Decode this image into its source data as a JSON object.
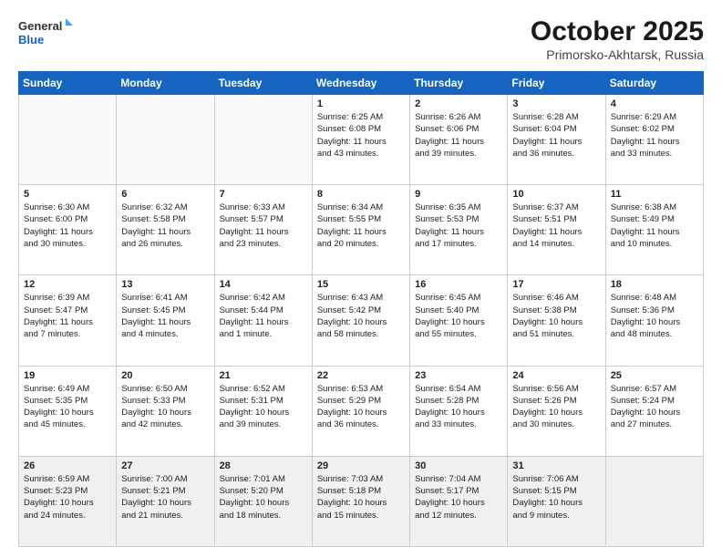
{
  "logo": {
    "line1": "General",
    "line2": "Blue"
  },
  "title": "October 2025",
  "subtitle": "Primorsko-Akhtarsk, Russia",
  "weekdays": [
    "Sunday",
    "Monday",
    "Tuesday",
    "Wednesday",
    "Thursday",
    "Friday",
    "Saturday"
  ],
  "weeks": [
    [
      {
        "day": "",
        "lines": []
      },
      {
        "day": "",
        "lines": []
      },
      {
        "day": "",
        "lines": []
      },
      {
        "day": "1",
        "lines": [
          "Sunrise: 6:25 AM",
          "Sunset: 6:08 PM",
          "Daylight: 11 hours",
          "and 43 minutes."
        ]
      },
      {
        "day": "2",
        "lines": [
          "Sunrise: 6:26 AM",
          "Sunset: 6:06 PM",
          "Daylight: 11 hours",
          "and 39 minutes."
        ]
      },
      {
        "day": "3",
        "lines": [
          "Sunrise: 6:28 AM",
          "Sunset: 6:04 PM",
          "Daylight: 11 hours",
          "and 36 minutes."
        ]
      },
      {
        "day": "4",
        "lines": [
          "Sunrise: 6:29 AM",
          "Sunset: 6:02 PM",
          "Daylight: 11 hours",
          "and 33 minutes."
        ]
      }
    ],
    [
      {
        "day": "5",
        "lines": [
          "Sunrise: 6:30 AM",
          "Sunset: 6:00 PM",
          "Daylight: 11 hours",
          "and 30 minutes."
        ]
      },
      {
        "day": "6",
        "lines": [
          "Sunrise: 6:32 AM",
          "Sunset: 5:58 PM",
          "Daylight: 11 hours",
          "and 26 minutes."
        ]
      },
      {
        "day": "7",
        "lines": [
          "Sunrise: 6:33 AM",
          "Sunset: 5:57 PM",
          "Daylight: 11 hours",
          "and 23 minutes."
        ]
      },
      {
        "day": "8",
        "lines": [
          "Sunrise: 6:34 AM",
          "Sunset: 5:55 PM",
          "Daylight: 11 hours",
          "and 20 minutes."
        ]
      },
      {
        "day": "9",
        "lines": [
          "Sunrise: 6:35 AM",
          "Sunset: 5:53 PM",
          "Daylight: 11 hours",
          "and 17 minutes."
        ]
      },
      {
        "day": "10",
        "lines": [
          "Sunrise: 6:37 AM",
          "Sunset: 5:51 PM",
          "Daylight: 11 hours",
          "and 14 minutes."
        ]
      },
      {
        "day": "11",
        "lines": [
          "Sunrise: 6:38 AM",
          "Sunset: 5:49 PM",
          "Daylight: 11 hours",
          "and 10 minutes."
        ]
      }
    ],
    [
      {
        "day": "12",
        "lines": [
          "Sunrise: 6:39 AM",
          "Sunset: 5:47 PM",
          "Daylight: 11 hours",
          "and 7 minutes."
        ]
      },
      {
        "day": "13",
        "lines": [
          "Sunrise: 6:41 AM",
          "Sunset: 5:45 PM",
          "Daylight: 11 hours",
          "and 4 minutes."
        ]
      },
      {
        "day": "14",
        "lines": [
          "Sunrise: 6:42 AM",
          "Sunset: 5:44 PM",
          "Daylight: 11 hours",
          "and 1 minute."
        ]
      },
      {
        "day": "15",
        "lines": [
          "Sunrise: 6:43 AM",
          "Sunset: 5:42 PM",
          "Daylight: 10 hours",
          "and 58 minutes."
        ]
      },
      {
        "day": "16",
        "lines": [
          "Sunrise: 6:45 AM",
          "Sunset: 5:40 PM",
          "Daylight: 10 hours",
          "and 55 minutes."
        ]
      },
      {
        "day": "17",
        "lines": [
          "Sunrise: 6:46 AM",
          "Sunset: 5:38 PM",
          "Daylight: 10 hours",
          "and 51 minutes."
        ]
      },
      {
        "day": "18",
        "lines": [
          "Sunrise: 6:48 AM",
          "Sunset: 5:36 PM",
          "Daylight: 10 hours",
          "and 48 minutes."
        ]
      }
    ],
    [
      {
        "day": "19",
        "lines": [
          "Sunrise: 6:49 AM",
          "Sunset: 5:35 PM",
          "Daylight: 10 hours",
          "and 45 minutes."
        ]
      },
      {
        "day": "20",
        "lines": [
          "Sunrise: 6:50 AM",
          "Sunset: 5:33 PM",
          "Daylight: 10 hours",
          "and 42 minutes."
        ]
      },
      {
        "day": "21",
        "lines": [
          "Sunrise: 6:52 AM",
          "Sunset: 5:31 PM",
          "Daylight: 10 hours",
          "and 39 minutes."
        ]
      },
      {
        "day": "22",
        "lines": [
          "Sunrise: 6:53 AM",
          "Sunset: 5:29 PM",
          "Daylight: 10 hours",
          "and 36 minutes."
        ]
      },
      {
        "day": "23",
        "lines": [
          "Sunrise: 6:54 AM",
          "Sunset: 5:28 PM",
          "Daylight: 10 hours",
          "and 33 minutes."
        ]
      },
      {
        "day": "24",
        "lines": [
          "Sunrise: 6:56 AM",
          "Sunset: 5:26 PM",
          "Daylight: 10 hours",
          "and 30 minutes."
        ]
      },
      {
        "day": "25",
        "lines": [
          "Sunrise: 6:57 AM",
          "Sunset: 5:24 PM",
          "Daylight: 10 hours",
          "and 27 minutes."
        ]
      }
    ],
    [
      {
        "day": "26",
        "lines": [
          "Sunrise: 6:59 AM",
          "Sunset: 5:23 PM",
          "Daylight: 10 hours",
          "and 24 minutes."
        ]
      },
      {
        "day": "27",
        "lines": [
          "Sunrise: 7:00 AM",
          "Sunset: 5:21 PM",
          "Daylight: 10 hours",
          "and 21 minutes."
        ]
      },
      {
        "day": "28",
        "lines": [
          "Sunrise: 7:01 AM",
          "Sunset: 5:20 PM",
          "Daylight: 10 hours",
          "and 18 minutes."
        ]
      },
      {
        "day": "29",
        "lines": [
          "Sunrise: 7:03 AM",
          "Sunset: 5:18 PM",
          "Daylight: 10 hours",
          "and 15 minutes."
        ]
      },
      {
        "day": "30",
        "lines": [
          "Sunrise: 7:04 AM",
          "Sunset: 5:17 PM",
          "Daylight: 10 hours",
          "and 12 minutes."
        ]
      },
      {
        "day": "31",
        "lines": [
          "Sunrise: 7:06 AM",
          "Sunset: 5:15 PM",
          "Daylight: 10 hours",
          "and 9 minutes."
        ]
      },
      {
        "day": "",
        "lines": []
      }
    ]
  ]
}
